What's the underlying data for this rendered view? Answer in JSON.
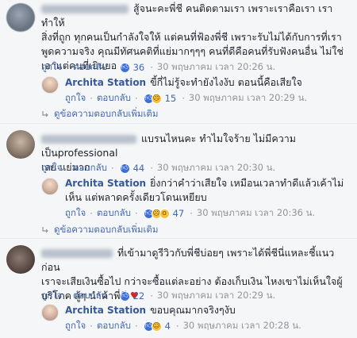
{
  "labels": {
    "like": "ถูกใจ",
    "reply": "ตอบกลับ",
    "more_replies": "ดูข้อความตอบกลับเพิ่มเติม",
    "sep": "·"
  },
  "comments": [
    {
      "text_line1": "สู้จนะคะพี่ชี คนติดตามเรา เพราะเราคือเรา เราทำให้",
      "text_line2": "สิ่งที่ถูก ทุกคนเป็นกำลังใจให้ แต่คนที่ฟ้องพี่ชี เพราะรับไม่ได้กับการที่เรา",
      "text_line3": "พูดความจริง คุณมีทัศนคติที่แย่มากๆๆๆ คนที่ดีคือคนที่รับฟังคนอื่น ไม่ใช่",
      "text_line4": "เอาแต่คนที่เยินยอ",
      "reaction_count": "36",
      "time": "30 พฤษภาคม เวลา 20:26 น.",
      "reply": {
        "name": "Archita Station",
        "text": "ขี้กี่ไม่รู้จะทำยังไงงับ ตอนนี้คือเสียใจ",
        "reaction_count": "15",
        "time": "30 พฤษภาคม เวลา 20:29 น."
      }
    },
    {
      "text_line1": "แบรนไหนคะ ทำไมใจร้าย ไม่มีความเป็นprofessional",
      "text_line2": "เลย แย่มาก",
      "reaction_count": "44",
      "time": "30 พฤษภาคม เวลา 20:30 น.",
      "reply": {
        "name": "Archita Station",
        "text_line1": "ยิ่งกว่าคำว่าเสียใจ เหมือนเวลาทำดีแล้วเค้าไม่",
        "text_line2": "เห็น แต่พลาดครั้งเดียวโดนเหยียบ",
        "reaction_count": "47",
        "time": "30 พฤษภาคม เวลา 20:36 น."
      }
    },
    {
      "text_line1": "ที่เข้ามาดูรีวิวกับพี่ชีบ่อยๆ เพราะได้พี่ชีนี่แหละชี้แนวก่อน",
      "text_line2": "เราจะเสียเงินซื้อไป กว่าจะซื้อแต่ละอย่าง ต้องเก็บเงิน ไหงเขาไม่เห็นใจผู้",
      "text_line3": "บริโภค สู้ๆ นำค้าพี่ชี",
      "heart": "♥",
      "reaction_count": "22",
      "time": "30 พฤษภาคม เวลา 20:29 น.",
      "reply": {
        "name": "Archita Station",
        "text": "ขอบคุณมากจริงๆงับ",
        "reaction_count": "4",
        "time": "30 พฤษภาคม เวลา 20:28 น."
      }
    }
  ],
  "colors": {
    "link": "#4267b2",
    "name": "#365899",
    "meta": "#90949c",
    "background": "#f5f6f7",
    "like_blue": "#3b6fd8",
    "heart_red": "#d6251e"
  },
  "icons": [
    "like-reaction-icon",
    "haha-reaction-icon",
    "wow-reaction-icon",
    "reply-arrow-icon",
    "heart-icon"
  ]
}
